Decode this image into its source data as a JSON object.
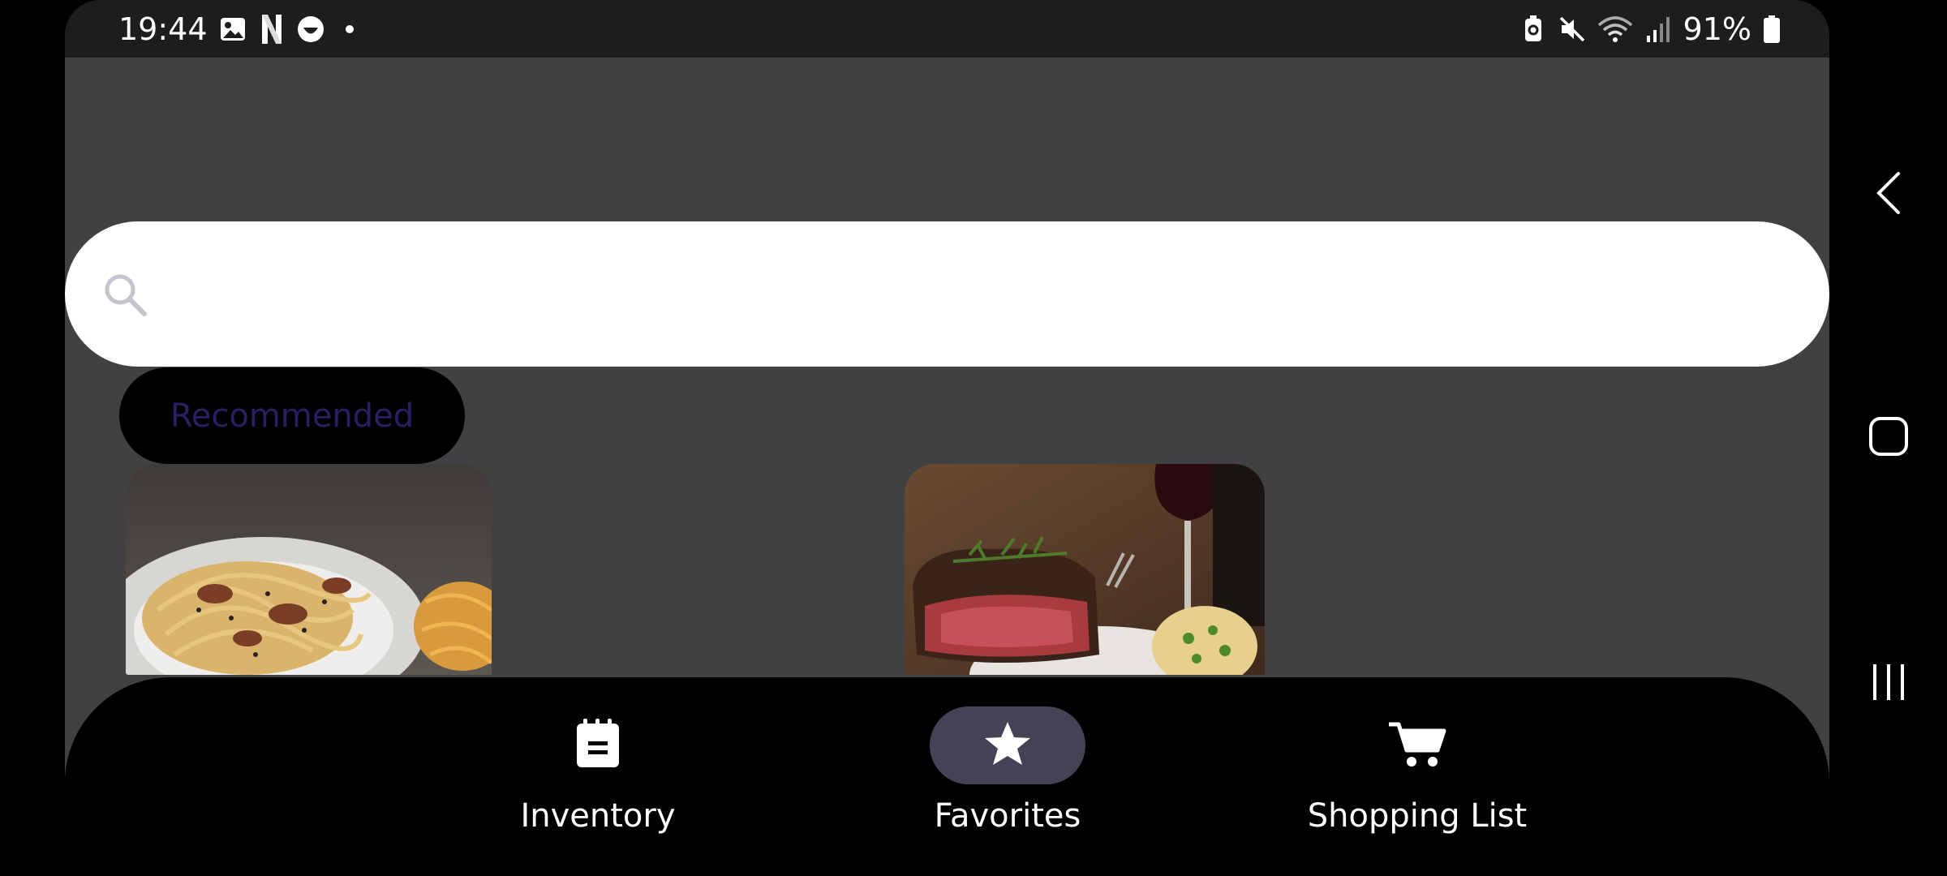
{
  "status_bar": {
    "time": "19:44",
    "battery": "91%",
    "left_icons": [
      "gallery-icon",
      "netflix-icon",
      "face-icon",
      "dot-icon"
    ],
    "right_icons": [
      "battery-saver-icon",
      "mute-icon",
      "wifi-icon",
      "signal-icon",
      "battery-icon"
    ]
  },
  "search": {
    "value": "",
    "placeholder": ""
  },
  "chip": {
    "label": "Recommended"
  },
  "recipes": [
    {
      "image": "carbonara-pasta-photo"
    },
    {
      "image": "steak-dinner-photo"
    }
  ],
  "bottom_nav": {
    "items": [
      {
        "label": "Inventory",
        "icon": "notepad-icon",
        "active": false
      },
      {
        "label": "Favorites",
        "icon": "star-icon",
        "active": true
      },
      {
        "label": "Shopping List",
        "icon": "cart-icon",
        "active": false
      }
    ]
  },
  "colors": {
    "background": "#414144",
    "status_bar": "#1d1d20",
    "nav_active": "#464255",
    "chip_text": "#2b1f63"
  }
}
